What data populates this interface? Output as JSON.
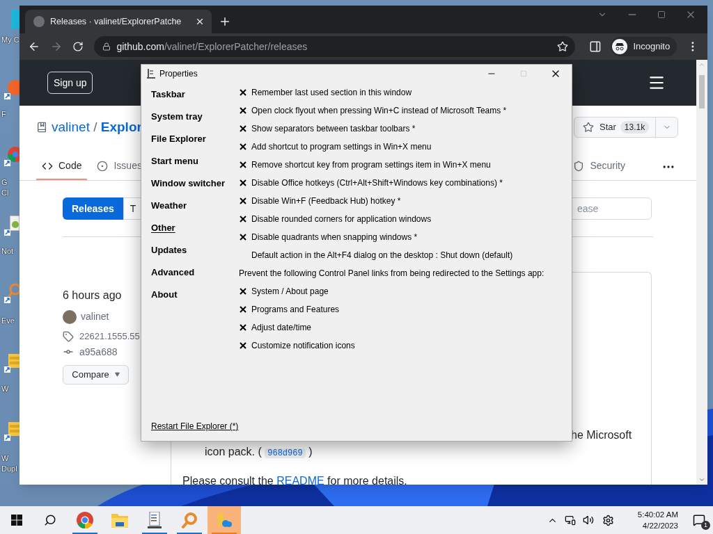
{
  "desktop": {
    "icons": [
      {
        "lines": [
          "My C"
        ]
      },
      {
        "lines": [
          "F"
        ]
      },
      {
        "lines": [
          "G",
          "Cl"
        ]
      },
      {
        "lines": [
          "Not"
        ]
      },
      {
        "lines": [
          "Eve"
        ]
      },
      {
        "lines": [
          "W"
        ]
      },
      {
        "lines": [
          "W",
          "Dupl"
        ]
      }
    ]
  },
  "browser": {
    "tab": {
      "title": "Releases · valinet/ExplorerPatche"
    },
    "address": {
      "host": "github.com",
      "path": "/valinet/ExplorerPatcher/releases"
    },
    "profile": "Incognito",
    "page": {
      "sign_up": "Sign up",
      "repo": {
        "owner": "valinet",
        "separator": "/",
        "name": "Explor"
      },
      "star": {
        "label": "Star",
        "count": "13.1k"
      },
      "tabs": [
        {
          "label": "Code",
          "selected": true
        },
        {
          "label": "Issues",
          "selected": false
        },
        {
          "label": "Security",
          "selected": false
        }
      ],
      "subnav": [
        {
          "label": "Releases",
          "selected": true
        },
        {
          "label": "T",
          "selected": false
        }
      ],
      "search": {
        "placeholder": "ease"
      },
      "release": {
        "time": "6 hours ago",
        "author": "valinet",
        "tag": "22621.1555.55",
        "commit": "a95a688",
        "compare": "Compare"
      },
      "notes": {
        "line_1": "he Microsoft",
        "line_2": {
          "before": "icon pack. (",
          "code": "968d969",
          "after": ")"
        },
        "line_3": {
          "before": "Please consult the ",
          "link": "README",
          "after": " for more details."
        }
      }
    }
  },
  "dialog": {
    "title": "Properties",
    "controls": {
      "maximize_disabled": true
    },
    "sections": [
      {
        "label": "Taskbar",
        "selected": false
      },
      {
        "label": "System tray",
        "selected": false
      },
      {
        "label": "File Explorer",
        "selected": false
      },
      {
        "label": "Start menu",
        "selected": false
      },
      {
        "label": "Window switcher",
        "selected": false
      },
      {
        "label": "Weather",
        "selected": false
      },
      {
        "label": "Other",
        "selected": true
      },
      {
        "label": "Updates",
        "selected": false
      },
      {
        "label": "Advanced",
        "selected": false
      },
      {
        "label": "About",
        "selected": false
      }
    ],
    "options": [
      {
        "kind": "check",
        "label": "Remember last used section in this window",
        "checked": true
      },
      {
        "kind": "check",
        "label": "Open clock flyout when pressing Win+C instead of Microsoft Teams *",
        "checked": true
      },
      {
        "kind": "check",
        "label": "Show separators between taskbar toolbars *",
        "checked": true
      },
      {
        "kind": "check",
        "label": "Add shortcut to program settings in Win+X menu",
        "checked": true
      },
      {
        "kind": "check",
        "label": "Remove shortcut key from program settings item in Win+X menu",
        "checked": true
      },
      {
        "kind": "check",
        "label": "Disable Office hotkeys (Ctrl+Alt+Shift+Windows key combinations) *",
        "checked": true
      },
      {
        "kind": "check",
        "label": "Disable Win+F (Feedback Hub) hotkey *",
        "checked": true
      },
      {
        "kind": "check",
        "label": "Disable rounded corners for application windows",
        "checked": true
      },
      {
        "kind": "check",
        "label": "Disable quadrants when snapping windows *",
        "checked": true
      },
      {
        "kind": "choice",
        "label": "Default action in the Alt+F4 dialog on the desktop : Shut down (default)"
      },
      {
        "kind": "heading",
        "label": "Prevent the following Control Panel links from being redirected to the Settings app:"
      },
      {
        "kind": "check",
        "label": "System / About page",
        "checked": true
      },
      {
        "kind": "check",
        "label": "Programs and Features",
        "checked": true
      },
      {
        "kind": "check",
        "label": "Adjust date/time",
        "checked": true
      },
      {
        "kind": "check",
        "label": "Customize notification icons",
        "checked": true
      }
    ],
    "footer_link": "Restart File Explorer (*)"
  },
  "taskbar": {
    "apps": [
      {
        "running": true,
        "selected": false
      },
      {
        "running": false,
        "selected": false
      },
      {
        "running": true,
        "selected": false
      },
      {
        "running": true,
        "selected": false
      },
      {
        "running": true,
        "selected": true
      }
    ],
    "time": "5:40:02 AM",
    "date": "4/22/2023",
    "notifications": "1"
  }
}
